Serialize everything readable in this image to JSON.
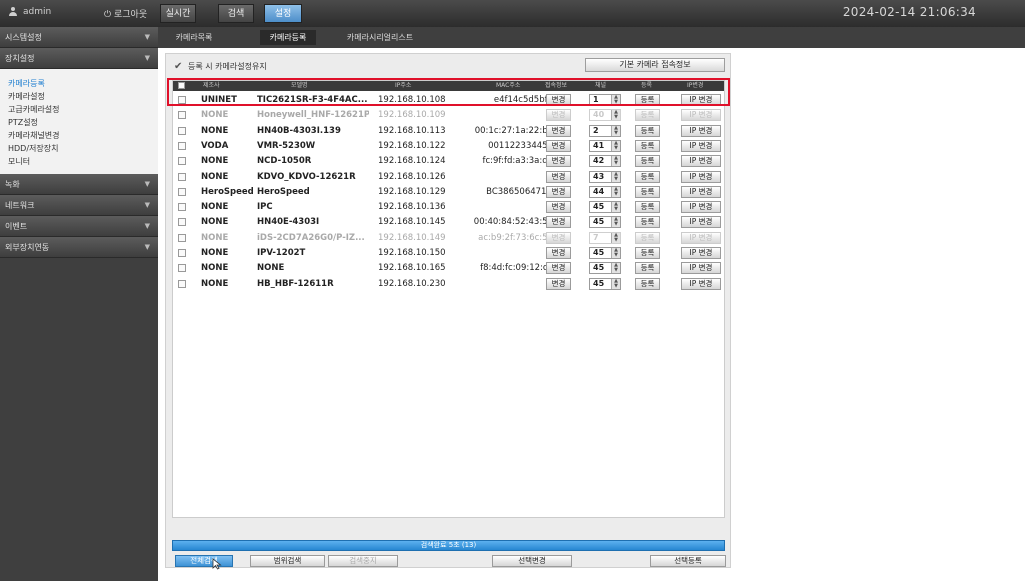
{
  "topbar": {
    "user": "admin",
    "logout": "로그아웃",
    "nav": {
      "live": "실시간",
      "search": "검색",
      "settings": "설정"
    },
    "datetime": "2024-02-14 21:06:34"
  },
  "sidebar": {
    "menus": {
      "system": "시스템설정",
      "device": "장치설정",
      "record": "녹화",
      "network": "네트워크",
      "event": "이벤트",
      "external": "외부장치연동"
    },
    "device_items": [
      "카메라등록",
      "카메라설정",
      "고급카메라설정",
      "PTZ설정",
      "카메라채널변경",
      "HDD/저장장치",
      "모니터"
    ]
  },
  "tabs": {
    "list": "카메라목록",
    "register": "카메라등록",
    "serial": "카메라시리얼리스트"
  },
  "main": {
    "keep_config": "등록 시 카메라설정유지",
    "default_info_button": "기본 카메라 접속정보",
    "headers": [
      "제조사",
      "모델명",
      "IP주소",
      "MAC주소",
      "접속정보",
      "채널",
      "등록",
      "IP변경"
    ],
    "rows": [
      {
        "type": "UNINET",
        "model": "TIC2621SR-F3-4F4AC...",
        "ip": "192.168.10.108",
        "mac": "e4f14c5d5bf5",
        "channel": "1",
        "dim": false
      },
      {
        "type": "NONE",
        "model": "Honeywell_HNF-12621P",
        "ip": "192.168.10.109",
        "mac": "",
        "channel": "40",
        "dim": true
      },
      {
        "type": "NONE",
        "model": "HN40B-4303I.139",
        "ip": "192.168.10.113",
        "mac": "00:1c:27:1a:22:bd",
        "channel": "2",
        "dim": false
      },
      {
        "type": "VODA",
        "model": "VMR-5230W",
        "ip": "192.168.10.122",
        "mac": "001122334455",
        "channel": "41",
        "dim": false
      },
      {
        "type": "NONE",
        "model": "NCD-1050R",
        "ip": "192.168.10.124",
        "mac": "fc:9f:fd:a3:3a:d7",
        "channel": "42",
        "dim": false
      },
      {
        "type": "NONE",
        "model": "KDVO_KDVO-12621R",
        "ip": "192.168.10.126",
        "mac": "",
        "channel": "43",
        "dim": false
      },
      {
        "type": "HeroSpeed",
        "model": "HeroSpeed",
        "ip": "192.168.10.129",
        "mac": "BC386506471D",
        "channel": "44",
        "dim": false
      },
      {
        "type": "NONE",
        "model": "IPC",
        "ip": "192.168.10.136",
        "mac": "",
        "channel": "45",
        "dim": false
      },
      {
        "type": "NONE",
        "model": "HN40E-4303I",
        "ip": "192.168.10.145",
        "mac": "00:40:84:52:43:51",
        "channel": "45",
        "dim": false
      },
      {
        "type": "NONE",
        "model": "iDS-2CD7A26G0/P-IZ...",
        "ip": "192.168.10.149",
        "mac": "ac:b9:2f:73:6c:51",
        "channel": "7",
        "dim": true
      },
      {
        "type": "NONE",
        "model": "IPV-1202T",
        "ip": "192.168.10.150",
        "mac": "",
        "channel": "45",
        "dim": false
      },
      {
        "type": "NONE",
        "model": "NONE",
        "ip": "192.168.10.165",
        "mac": "f8:4d:fc:09:12:c4",
        "channel": "45",
        "dim": false
      },
      {
        "type": "NONE",
        "model": "HB_HBF-12611R",
        "ip": "192.168.10.230",
        "mac": "",
        "channel": "45",
        "dim": false
      }
    ],
    "row_buttons": {
      "change": "변경",
      "register": "등록",
      "ip_change": "IP 변경"
    },
    "status": "검색완료 5초 (13)",
    "buttons": {
      "all_search": "전체검색",
      "range_search": "범위검색",
      "stop_search": "검색중지",
      "selected_change": "선택변경",
      "selected_register": "선택등록"
    }
  }
}
